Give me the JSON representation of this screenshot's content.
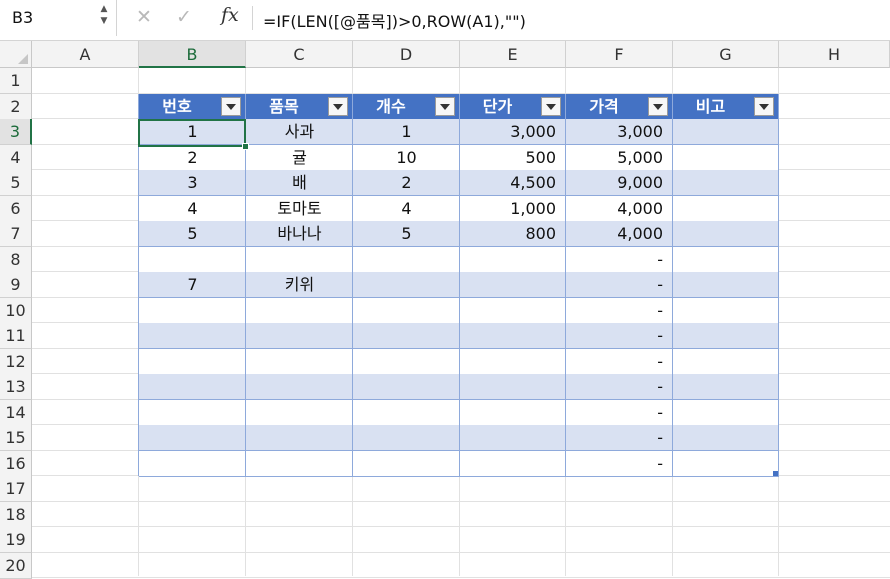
{
  "formula_bar": {
    "name_box": "B3",
    "cancel_icon": "✕",
    "enter_icon": "✓",
    "fx_label": "fx",
    "formula": "=IF(LEN([@품목])>0,ROW(A1),\"\")"
  },
  "columns": [
    "A",
    "B",
    "C",
    "D",
    "E",
    "F",
    "G",
    "H"
  ],
  "rows": [
    "1",
    "2",
    "3",
    "4",
    "5",
    "6",
    "7",
    "8",
    "9",
    "10",
    "11",
    "12",
    "13",
    "14",
    "15",
    "16",
    "17",
    "18",
    "19",
    "20"
  ],
  "table": {
    "headers": [
      "번호",
      "품목",
      "개수",
      "단가",
      "가격",
      "비고"
    ],
    "rows": [
      [
        "1",
        "사과",
        "1",
        "3,000",
        "3,000",
        ""
      ],
      [
        "2",
        "귤",
        "10",
        "500",
        "5,000",
        ""
      ],
      [
        "3",
        "배",
        "2",
        "4,500",
        "9,000",
        ""
      ],
      [
        "4",
        "토마토",
        "4",
        "1,000",
        "4,000",
        ""
      ],
      [
        "5",
        "바나나",
        "5",
        "800",
        "4,000",
        ""
      ],
      [
        "",
        "",
        "",
        "",
        "-",
        ""
      ],
      [
        "7",
        "키위",
        "",
        "",
        "-",
        ""
      ],
      [
        "",
        "",
        "",
        "",
        "-",
        ""
      ],
      [
        "",
        "",
        "",
        "",
        "-",
        ""
      ],
      [
        "",
        "",
        "",
        "",
        "-",
        ""
      ],
      [
        "",
        "",
        "",
        "",
        "-",
        ""
      ],
      [
        "",
        "",
        "",
        "",
        "-",
        ""
      ],
      [
        "",
        "",
        "",
        "",
        "-",
        ""
      ],
      [
        "",
        "",
        "",
        "",
        "-",
        ""
      ]
    ]
  },
  "colors": {
    "header_fill": "#4472c4",
    "band_fill": "#d9e1f2",
    "selection": "#217346"
  }
}
